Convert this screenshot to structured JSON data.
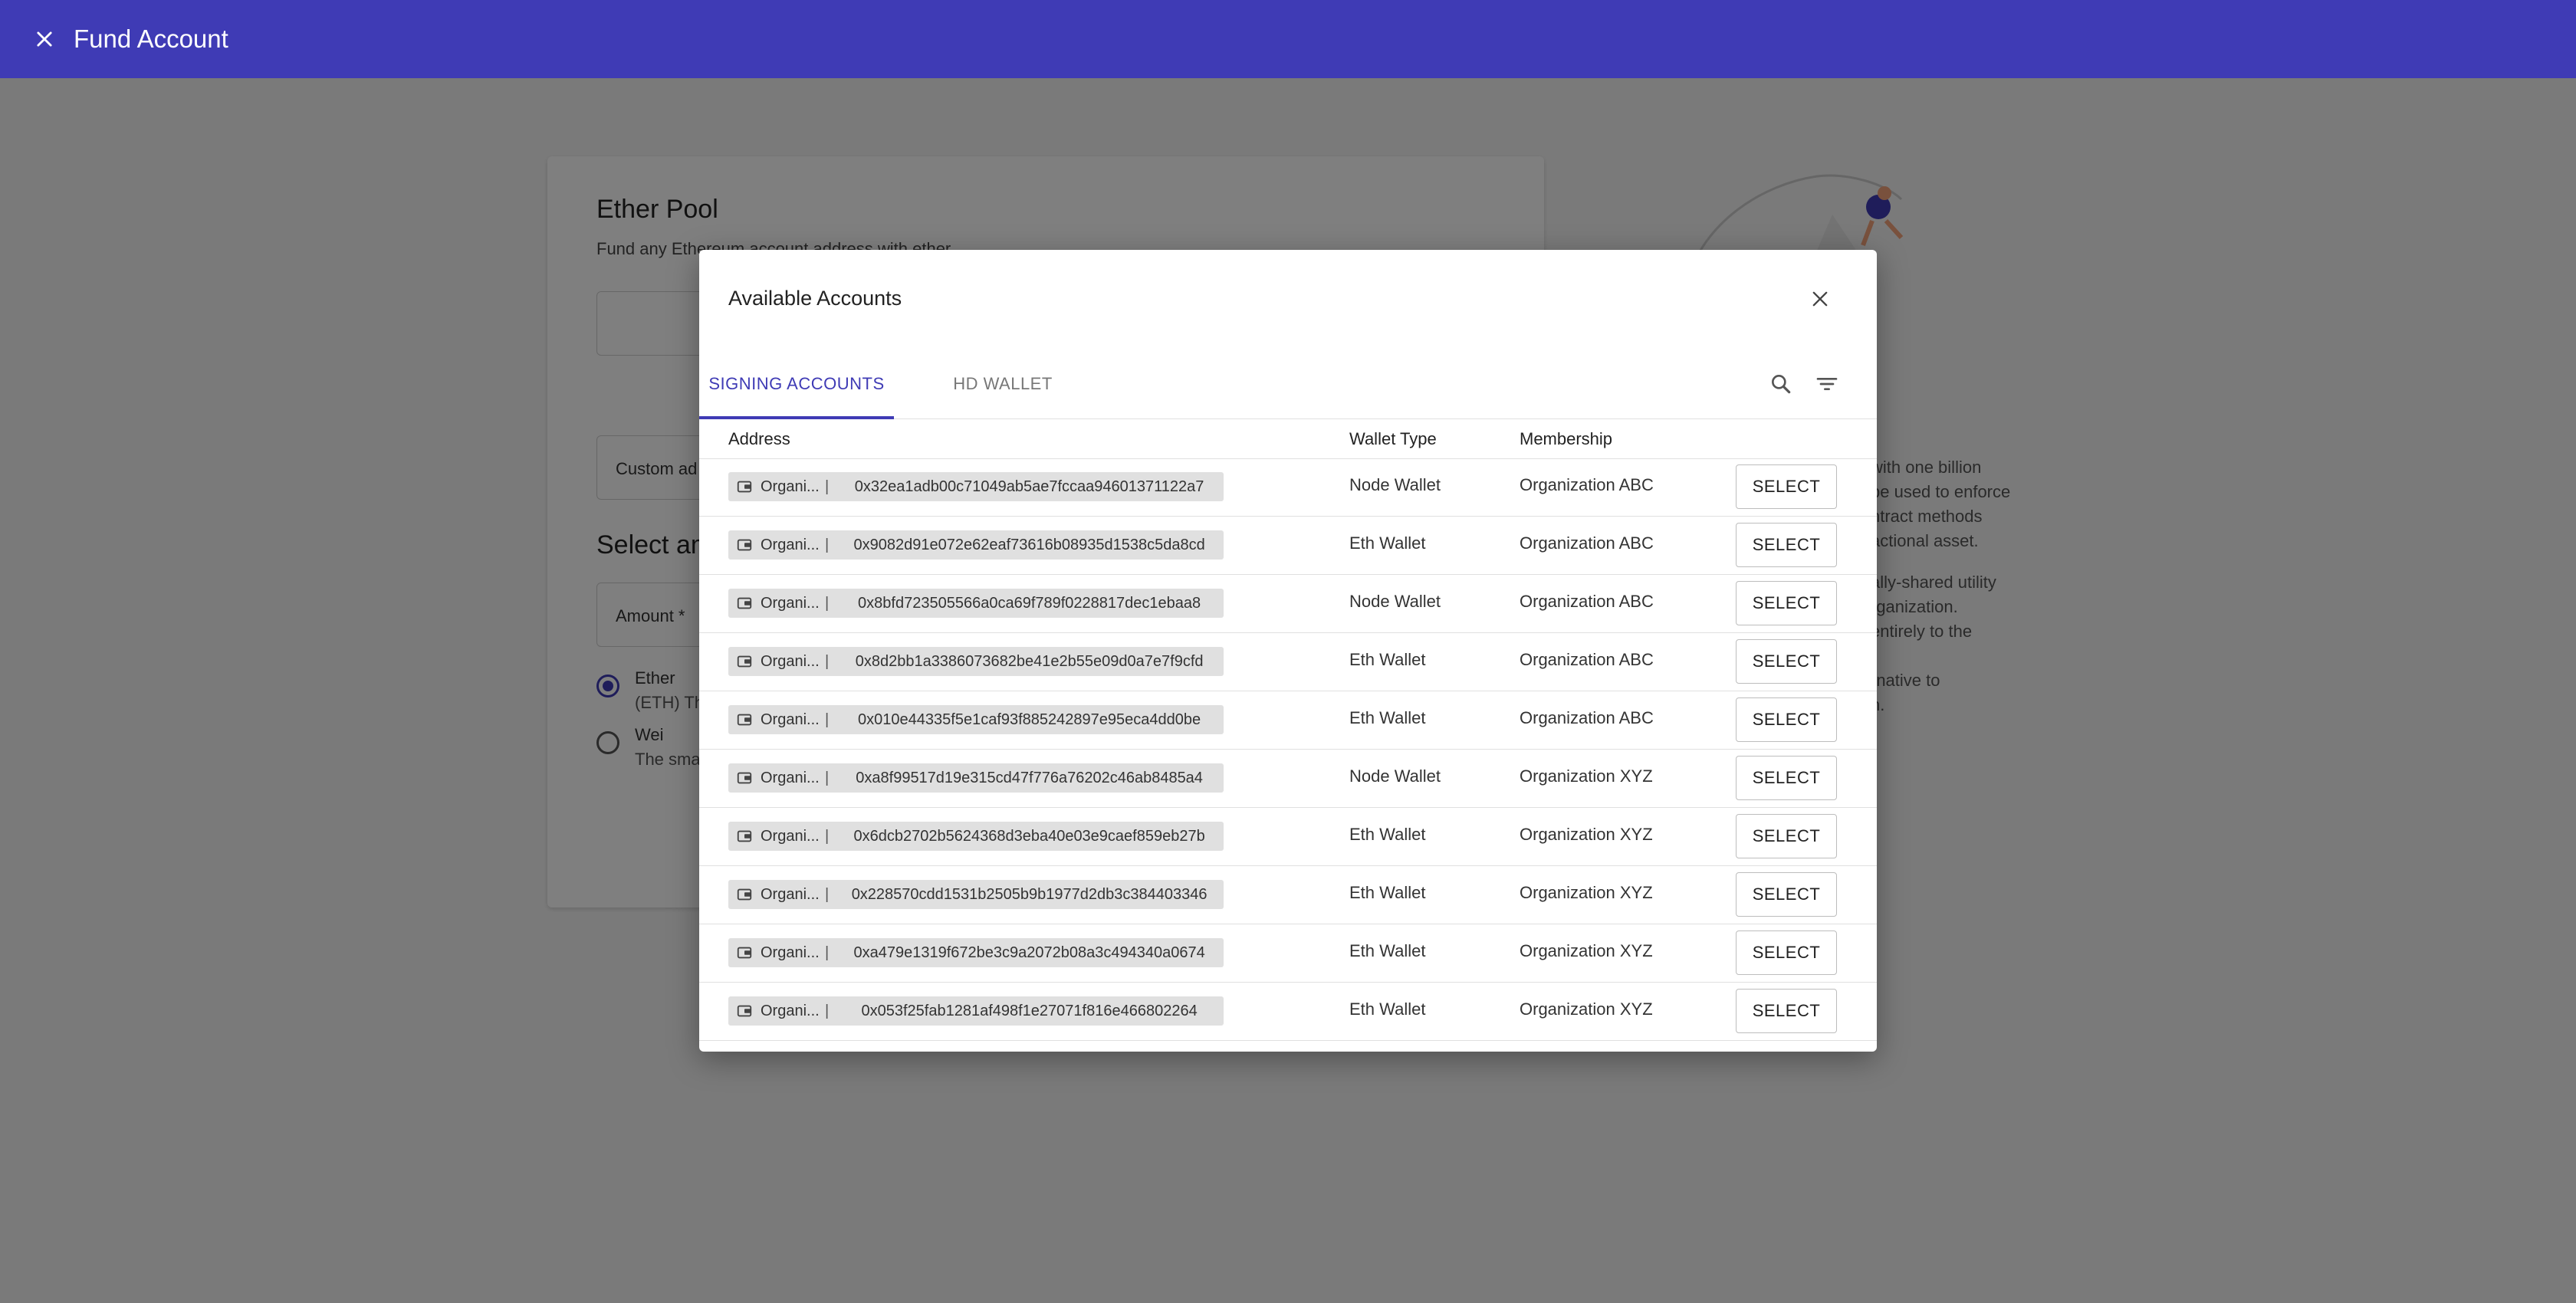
{
  "appbar": {
    "title": "Fund Account"
  },
  "card": {
    "title": "Ether Pool",
    "subtitle": "Fund any Ethereum account address with ether.",
    "custom_address_label": "Custom ad",
    "select_amount_heading": "Select am",
    "amount_label": "Amount *",
    "radio_options": [
      {
        "label": "Ether",
        "desc": "(ETH) Th",
        "checked": true
      },
      {
        "label": "Wei",
        "desc": "The sma",
        "checked": false
      }
    ]
  },
  "right_text": {
    "para1": [
      "with one billion",
      "be used to enforce",
      "ntract methods",
      "actional asset."
    ],
    "para2": [
      "ally-shared utility",
      "rganization.",
      "entirely to the"
    ],
    "para3": [
      "rnative to",
      "n."
    ]
  },
  "dialog": {
    "title": "Available Accounts",
    "tabs": [
      {
        "label": "SIGNING ACCOUNTS",
        "active": true
      },
      {
        "label": "HD WALLET",
        "active": false
      }
    ],
    "columns": {
      "address": "Address",
      "wallet_type": "Wallet Type",
      "membership": "Membership"
    },
    "select_label": "SELECT",
    "rows": [
      {
        "org": "Organi...",
        "address": "0x32ea1adb00c71049ab5ae7fccaa94601371122a7",
        "wallet_type": "Node Wallet",
        "membership": "Organization ABC"
      },
      {
        "org": "Organi...",
        "address": "0x9082d91e072e62eaf73616b08935d1538c5da8cd",
        "wallet_type": "Eth Wallet",
        "membership": "Organization ABC"
      },
      {
        "org": "Organi...",
        "address": "0x8bfd723505566a0ca69f789f0228817dec1ebaa8",
        "wallet_type": "Node Wallet",
        "membership": "Organization ABC"
      },
      {
        "org": "Organi...",
        "address": "0x8d2bb1a3386073682be41e2b55e09d0a7e7f9cfd",
        "wallet_type": "Eth Wallet",
        "membership": "Organization ABC"
      },
      {
        "org": "Organi...",
        "address": "0x010e44335f5e1caf93f885242897e95eca4dd0be",
        "wallet_type": "Eth Wallet",
        "membership": "Organization ABC"
      },
      {
        "org": "Organi...",
        "address": "0xa8f99517d19e315cd47f776a76202c46ab8485a4",
        "wallet_type": "Node Wallet",
        "membership": "Organization XYZ"
      },
      {
        "org": "Organi...",
        "address": "0x6dcb2702b5624368d3eba40e03e9caef859eb27b",
        "wallet_type": "Eth Wallet",
        "membership": "Organization XYZ"
      },
      {
        "org": "Organi...",
        "address": "0x228570cdd1531b2505b9b1977d2db3c384403346",
        "wallet_type": "Eth Wallet",
        "membership": "Organization XYZ"
      },
      {
        "org": "Organi...",
        "address": "0xa479e1319f672be3c9a2072b08a3c494340a0674",
        "wallet_type": "Eth Wallet",
        "membership": "Organization XYZ"
      },
      {
        "org": "Organi...",
        "address": "0x053f25fab1281af498f1e27071f816e466802264",
        "wallet_type": "Eth Wallet",
        "membership": "Organization XYZ"
      }
    ]
  },
  "colors": {
    "primary": "#3f3bb5",
    "overlay": "rgba(0,0,0,0.5)"
  },
  "icons": {
    "close": "close-icon",
    "search": "search-icon",
    "filter": "filter-icon",
    "wallet": "wallet-icon"
  }
}
